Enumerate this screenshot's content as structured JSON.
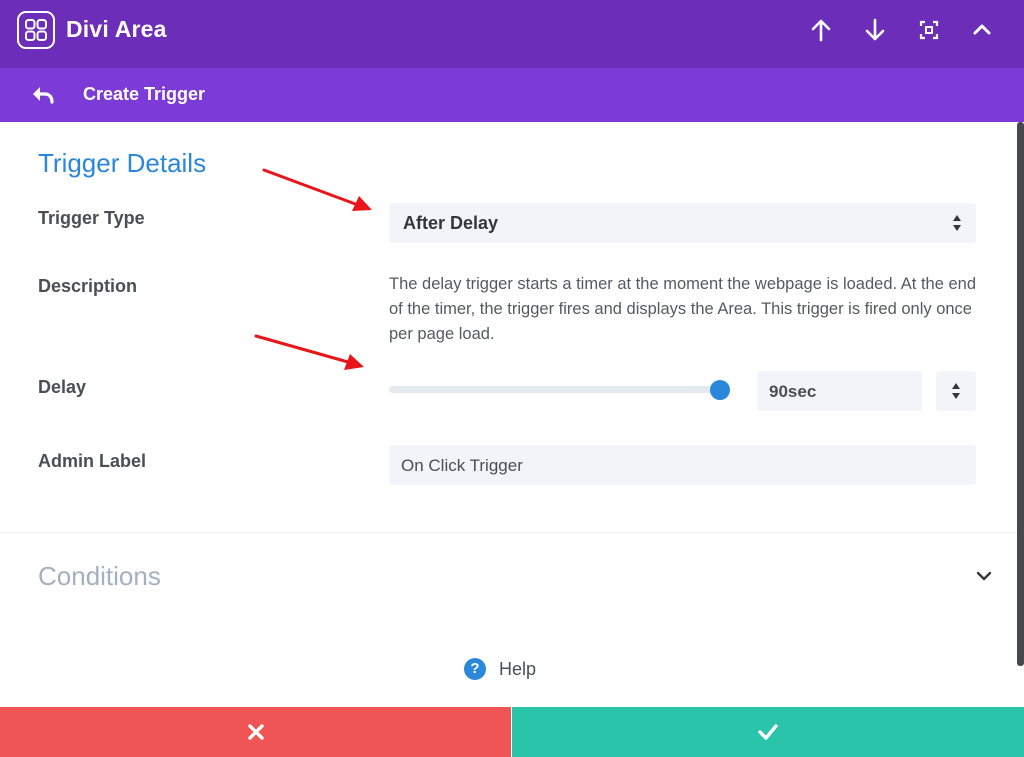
{
  "app": {
    "title": "Divi Area",
    "logo_icon": "grid-logo-icon"
  },
  "toolbar": {
    "icons": [
      "arrow-up-icon",
      "arrow-down-icon",
      "focus-icon",
      "collapse-icon"
    ]
  },
  "subheader": {
    "title": "Create Trigger",
    "back_icon": "undo-back-icon"
  },
  "details": {
    "section_title": "Trigger Details",
    "trigger_type": {
      "label": "Trigger Type",
      "value": "After Delay"
    },
    "description": {
      "label": "Description",
      "text": "The delay trigger starts a timer at the moment the webpage is loaded. At the end of the timer, the trigger fires and displays the Area. This trigger is fired only once per page load."
    },
    "delay": {
      "label": "Delay",
      "value": "90sec",
      "slider_fraction": 1.0
    },
    "admin_label": {
      "label": "Admin Label",
      "value": "On Click Trigger"
    }
  },
  "conditions": {
    "title": "Conditions"
  },
  "help": {
    "label": "Help"
  },
  "footer": {
    "cancel_icon": "close-icon",
    "save_icon": "check-icon"
  },
  "colors": {
    "topbar": "#6c2eb9",
    "subbar": "#7c3bd6",
    "accent": "#2b87da",
    "cancel": "#ef5555",
    "save": "#29c4a9",
    "annotation_arrow": "#e8161b"
  }
}
